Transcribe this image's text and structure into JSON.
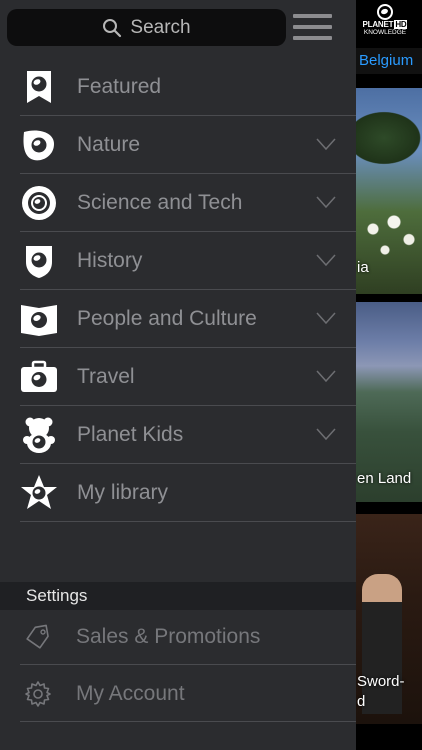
{
  "search": {
    "placeholder": "Search"
  },
  "background": {
    "logo_line1": "PLANET",
    "logo_hd": "HD",
    "logo_line2": "KNOWLEDGE",
    "region": "Belgium",
    "captions": [
      "ia",
      "en Land",
      "Sword-\nd"
    ]
  },
  "menu": {
    "items": [
      {
        "label": "Featured",
        "icon": "bookmark-globe-icon",
        "expandable": false
      },
      {
        "label": "Nature",
        "icon": "leaf-globe-icon",
        "expandable": true
      },
      {
        "label": "Science and Tech",
        "icon": "atom-globe-icon",
        "expandable": true
      },
      {
        "label": "History",
        "icon": "shield-globe-icon",
        "expandable": true
      },
      {
        "label": "People and Culture",
        "icon": "book-globe-icon",
        "expandable": true
      },
      {
        "label": "Travel",
        "icon": "suitcase-globe-icon",
        "expandable": true
      },
      {
        "label": "Planet Kids",
        "icon": "teddy-bear-icon",
        "expandable": true
      },
      {
        "label": "My library",
        "icon": "star-globe-icon",
        "expandable": false
      }
    ]
  },
  "settings": {
    "header": "Settings",
    "items": [
      {
        "label": "Sales & Promotions",
        "icon": "price-tag-icon"
      },
      {
        "label": "My Account",
        "icon": "gear-icon"
      }
    ]
  },
  "colors": {
    "menu_bg": "#2b2c2f",
    "menu_text": "#8f9094",
    "accent_link": "#2a9bff",
    "divider": "#4a4b4f"
  }
}
